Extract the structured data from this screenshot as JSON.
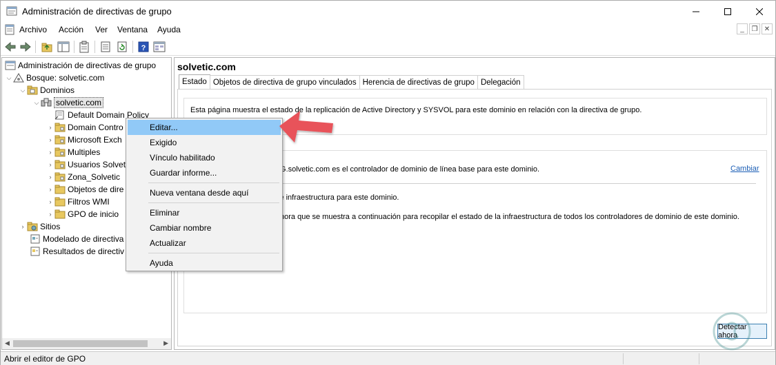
{
  "window": {
    "title": "Administración de directivas de grupo",
    "controls": {
      "minimize": "—",
      "maximize": "☐",
      "close": "✕"
    }
  },
  "menu": {
    "items": [
      "Archivo",
      "Acción",
      "Ver",
      "Ventana",
      "Ayuda"
    ],
    "mdi": {
      "minimize": "_",
      "restore": "❐",
      "close": "✕"
    }
  },
  "toolbar": {
    "icons": [
      "back-icon",
      "forward-icon",
      "up-folder-icon",
      "show-hide-tree-icon",
      "clipboard-icon",
      "properties-icon",
      "refresh-icon",
      "help-icon",
      "console-icon"
    ]
  },
  "tree": {
    "root": "Administración de directivas de grupo",
    "forest": "Bosque: solvetic.com",
    "domains": "Dominios",
    "domain": "solvetic.com",
    "children": [
      "Default Domain Policy",
      "Domain Contro",
      "Microsoft Exch",
      "Multiples",
      "Usuarios Solvet",
      "Zona_Solvetic",
      "Objetos de dire",
      "Filtros WMI",
      "GPO de inicio"
    ],
    "sites": "Sitios",
    "modeling": "Modelado de directiva",
    "results": "Resultados de directiv"
  },
  "right": {
    "title": "solvetic.com",
    "tabs": [
      "Estado",
      "Objetos de directiva de grupo vinculados",
      "Herencia de directivas de grupo",
      "Delegación"
    ],
    "info": "Esta página muestra el estado de la replicación de Active Directory y SYSVOL para este dominio en relación con la directiva de grupo.",
    "baseline": "G9BG.solvetic.com es el controlador de dominio de línea base para este dominio.",
    "change_link": "Cambiar",
    "infra": "do de infraestructura para este dominio.",
    "detect_text": "tar ahora que se muestra a continuación para recopilar el estado de la infraestructura de todos los controladores de dominio de este dominio.",
    "detect_button": "Detectar ahora"
  },
  "context_menu": {
    "items": [
      "Editar...",
      "Exigido",
      "Vínculo habilitado",
      "Guardar informe...",
      "Nueva ventana desde aquí",
      "Eliminar",
      "Cambiar nombre",
      "Actualizar",
      "Ayuda"
    ]
  },
  "status": {
    "text": "Abrir el editor de GPO"
  },
  "colors": {
    "highlight": "#91c9f7",
    "link": "#1a5db5",
    "arrow": "#e8525a"
  }
}
